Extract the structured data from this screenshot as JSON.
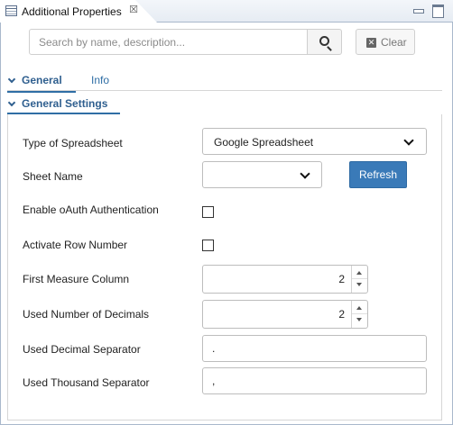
{
  "view": {
    "title": "Additional Properties",
    "close_glyph": "☒",
    "icons": [
      "properties-icon",
      "close-icon",
      "minimize-icon",
      "maximize-icon"
    ]
  },
  "search": {
    "placeholder": "Search by name, description...",
    "value": "",
    "clear_label": "Clear"
  },
  "tabs": [
    {
      "label": "General",
      "active": true
    },
    {
      "label": "Info",
      "active": false
    }
  ],
  "group": {
    "title": "General Settings"
  },
  "fields": {
    "spreadsheet_type": {
      "label": "Type of Spreadsheet",
      "value": "Google Spreadsheet"
    },
    "sheet_name": {
      "label": "Sheet Name",
      "value": "",
      "refresh_label": "Refresh"
    },
    "oauth": {
      "label": "Enable oAuth Authentication",
      "checked": false
    },
    "row_number": {
      "label": "Activate Row Number",
      "checked": false
    },
    "first_measure_column": {
      "label": "First Measure Column",
      "value": "2"
    },
    "decimals": {
      "label": "Used Number of Decimals",
      "value": "2"
    },
    "decimal_separator": {
      "label": "Used Decimal Separator",
      "value": "."
    },
    "thousand_separator": {
      "label": "Used Thousand Separator",
      "value": ","
    }
  },
  "colors": {
    "accent": "#2f6ea5",
    "button_primary": "#3a7ab8",
    "border": "#bdbdbd"
  }
}
